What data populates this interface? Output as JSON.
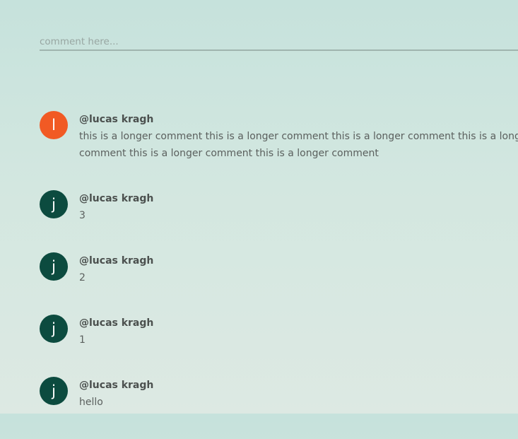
{
  "composer": {
    "placeholder": "comment here...",
    "value": ""
  },
  "colors": {
    "avatar_orange": "#f15a24",
    "avatar_green": "#0c4b3f"
  },
  "comments": [
    {
      "avatar_letter": "l",
      "avatar_color": "#f15a24",
      "author": "@lucas kragh",
      "text": "this is a longer comment this is a longer comment this is a longer comment this is a longer comment this is a longer comment this is a longer comment"
    },
    {
      "avatar_letter": "j",
      "avatar_color": "#0c4b3f",
      "author": "@lucas kragh",
      "text": "3"
    },
    {
      "avatar_letter": "j",
      "avatar_color": "#0c4b3f",
      "author": "@lucas kragh",
      "text": "2"
    },
    {
      "avatar_letter": "j",
      "avatar_color": "#0c4b3f",
      "author": "@lucas kragh",
      "text": "1"
    },
    {
      "avatar_letter": "j",
      "avatar_color": "#0c4b3f",
      "author": "@lucas kragh",
      "text": "hello"
    }
  ]
}
